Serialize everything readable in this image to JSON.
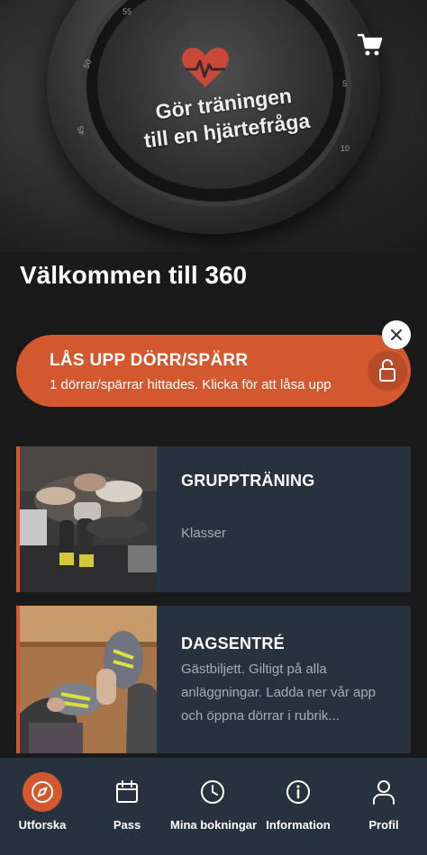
{
  "hero": {
    "headline_line1": "Gör träningen",
    "headline_line2": "till en hjärtefråga",
    "watch_ticks": [
      "55",
      "50",
      "45",
      "5",
      "10"
    ],
    "cart_icon": "cart-icon"
  },
  "welcome": "Välkommen till 360",
  "unlock": {
    "title": "LÅS UPP DÖRR/SPÄRR",
    "subtitle": "1 dörrar/spärrar hittades. Klicka för att låsa upp",
    "lock_icon": "unlock-icon",
    "close_icon": "close-icon"
  },
  "cards": [
    {
      "title": "GRUPPTRÄNING",
      "subtitle": "Klasser"
    },
    {
      "title": "DAGSENTRÉ",
      "subtitle": "Gästbiljett. Giltigt på alla anläggningar. Ladda ner vår app och öppna dörrar i rubrik..."
    }
  ],
  "nav": [
    {
      "label": "Utforska",
      "icon": "compass-icon",
      "active": true
    },
    {
      "label": "Pass",
      "icon": "calendar-icon",
      "active": false
    },
    {
      "label": "Mina bokningar",
      "icon": "clock-icon",
      "active": false
    },
    {
      "label": "Information",
      "icon": "info-icon",
      "active": false
    },
    {
      "label": "Profil",
      "icon": "person-icon",
      "active": false
    }
  ],
  "colors": {
    "accent": "#d4582f",
    "card_bg": "#28323e",
    "background": "#1a1a1a"
  }
}
